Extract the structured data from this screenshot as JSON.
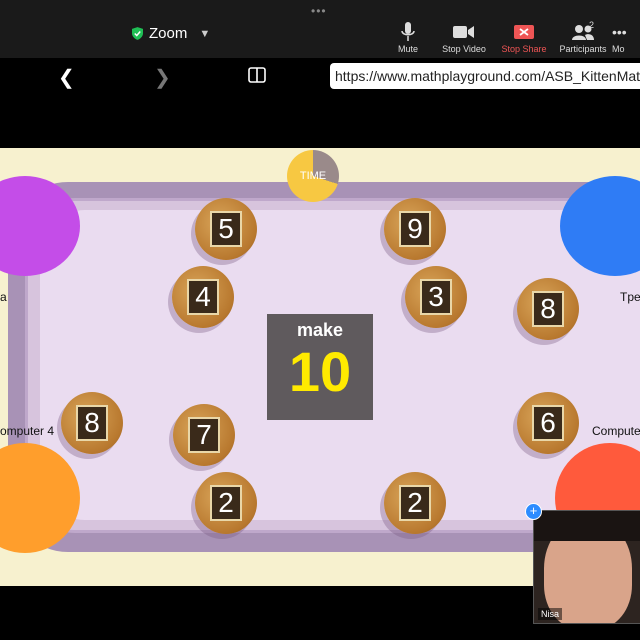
{
  "zoom": {
    "dots": "•••",
    "title": "Zoom",
    "controls": [
      {
        "label": "Mute",
        "icon": "microphone-icon"
      },
      {
        "label": "Stop Video",
        "icon": "video-camera-icon"
      },
      {
        "label": "Stop Share",
        "icon": "stop-share-icon"
      },
      {
        "label": "Participants",
        "icon": "participants-icon",
        "count": "2"
      },
      {
        "label": "Mo",
        "icon": "more-icon"
      }
    ]
  },
  "browser": {
    "url": "https://www.mathplayground.com/ASB_KittenMatch"
  },
  "game": {
    "timer_label": "TIME",
    "make_label": "make",
    "target": "10",
    "cookies": [
      "5",
      "9",
      "4",
      "3",
      "8",
      "8",
      "7",
      "6",
      "2",
      "2"
    ],
    "players": [
      "a",
      "Tpe",
      "omputer 4",
      "Compute"
    ]
  },
  "self_view": {
    "name": "Nisa"
  },
  "colors": {
    "zoom_bar": "#1a1a1a",
    "share_red": "#e55555",
    "target_yellow": "#ffea00",
    "table_purple": "#a892b6"
  }
}
